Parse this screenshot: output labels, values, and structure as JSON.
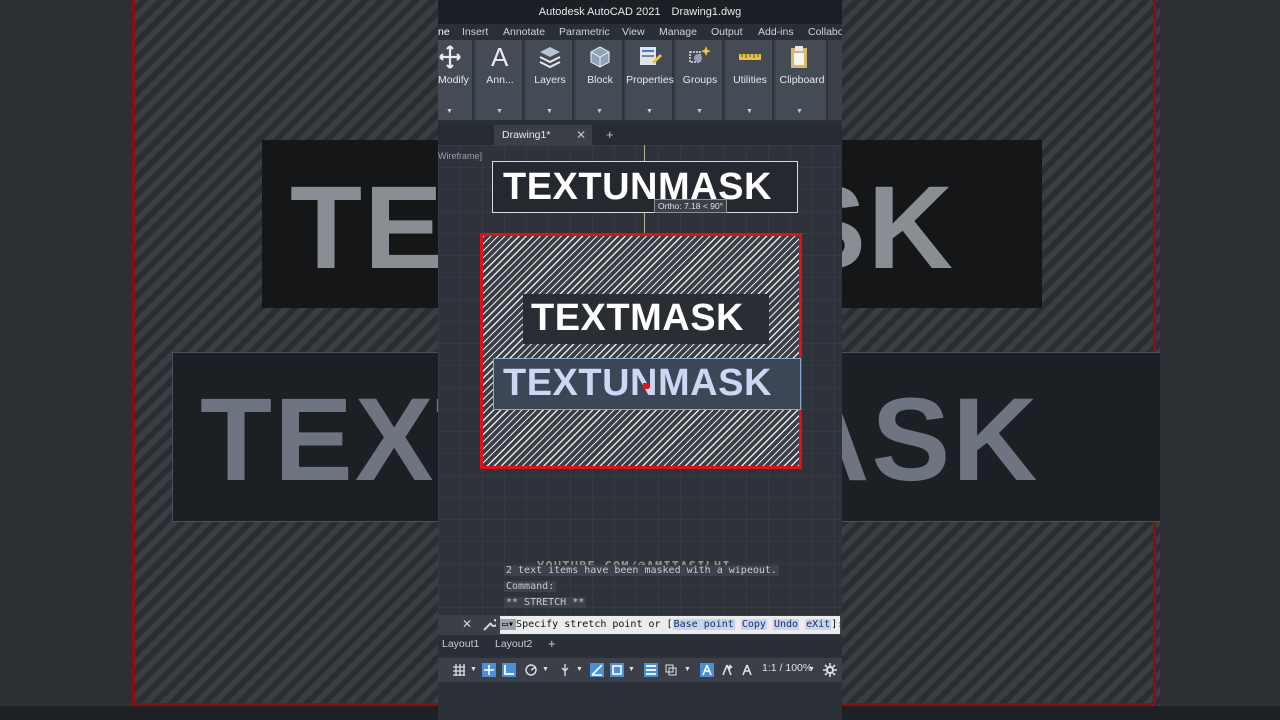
{
  "title_bar": {
    "app": "Autodesk AutoCAD 2021",
    "file": "Drawing1.dwg"
  },
  "menu": [
    "ne",
    "Insert",
    "Annotate",
    "Parametric",
    "View",
    "Manage",
    "Output",
    "Add-ins",
    "Collabo"
  ],
  "ribbon": [
    {
      "label": "Modify",
      "icon": "move-icon"
    },
    {
      "label": "Ann...",
      "icon": "annotation-text-icon"
    },
    {
      "label": "Layers",
      "icon": "layers-icon"
    },
    {
      "label": "Block",
      "icon": "block-icon"
    },
    {
      "label": "Properties",
      "icon": "properties-icon"
    },
    {
      "label": "Groups",
      "icon": "groups-icon"
    },
    {
      "label": "Utilities",
      "icon": "measure-icon"
    },
    {
      "label": "Clipboard",
      "icon": "clipboard-icon"
    }
  ],
  "doc_tab": {
    "name": "Drawing1*",
    "close": "✕",
    "add": "+"
  },
  "viewport_label": "Wireframe]",
  "drawing": {
    "text_top": "TEXTUNMASK",
    "text_masked": "TEXTMASK",
    "text_selected": "TEXTUNMASK",
    "ortho_tooltip": "Ortho: 7.18 < 90°"
  },
  "watermark": "YOUTUBE.COM/@AMITASILHI",
  "command_history": [
    "2 text items have been masked with a wipeout.",
    "Command:",
    "** STRETCH **"
  ],
  "command_prompt": {
    "prefix": "Specify stretch point or [",
    "options": [
      "Base point",
      "Copy",
      "Undo",
      "eXit"
    ],
    "suffix": "]:"
  },
  "layouts": [
    "Layout1",
    "Layout2",
    "+"
  ],
  "status": {
    "scale": "1:1 / 100%"
  },
  "colors": {
    "selection_border": "#e0101a",
    "accent": "#4aa3ff"
  }
}
